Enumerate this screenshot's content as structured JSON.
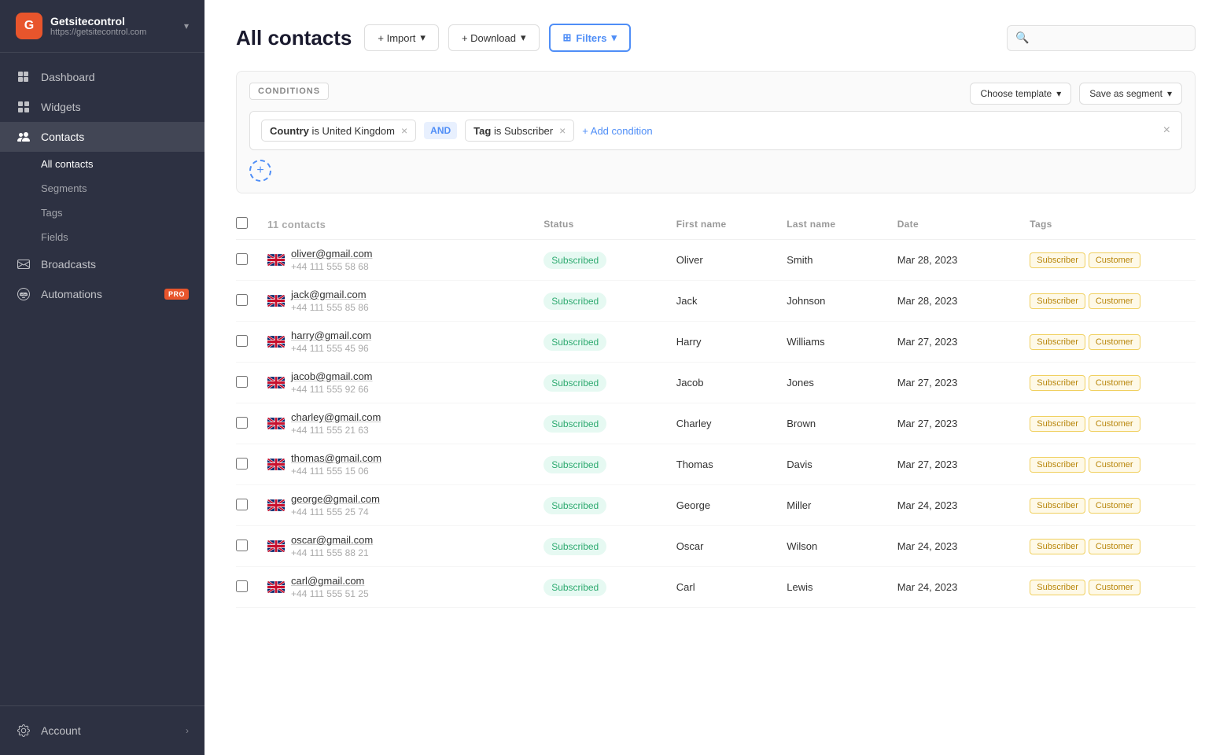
{
  "app": {
    "brand": "Getsitecontrol",
    "url": "https://getsitecontrol.com"
  },
  "sidebar": {
    "nav_items": [
      {
        "id": "dashboard",
        "label": "Dashboard",
        "icon": "grid"
      },
      {
        "id": "widgets",
        "label": "Widgets",
        "icon": "widget"
      },
      {
        "id": "contacts",
        "label": "Contacts",
        "icon": "contacts",
        "active": true
      },
      {
        "id": "broadcasts",
        "label": "Broadcasts",
        "icon": "email"
      },
      {
        "id": "automations",
        "label": "Automations",
        "icon": "auto",
        "pro": true
      }
    ],
    "contacts_sub": [
      {
        "id": "all-contacts",
        "label": "All contacts",
        "active": true
      },
      {
        "id": "segments",
        "label": "Segments"
      },
      {
        "id": "tags",
        "label": "Tags"
      },
      {
        "id": "fields",
        "label": "Fields"
      }
    ],
    "footer": {
      "label": "Account",
      "icon": "gear"
    }
  },
  "toolbar": {
    "import_label": "+ Import",
    "download_label": "+ Download",
    "filters_label": "⊞ Filters",
    "search_placeholder": ""
  },
  "page": {
    "title": "All contacts"
  },
  "conditions": {
    "label": "CONDITIONS",
    "choose_template": "Choose template",
    "save_as_segment": "Save as segment",
    "condition1_field": "Country",
    "condition1_op": "is",
    "condition1_val": "United Kingdom",
    "and_label": "AND",
    "condition2_field": "Tag",
    "condition2_op": "is",
    "condition2_val": "Subscriber",
    "add_condition": "+ Add condition"
  },
  "table": {
    "count_label": "11 contacts",
    "columns": {
      "status": "Status",
      "first_name": "First name",
      "last_name": "Last name",
      "date": "Date",
      "tags": "Tags"
    },
    "rows": [
      {
        "email": "oliver@gmail.com",
        "phone": "+44 111 555 58 68",
        "status": "Subscribed",
        "first_name": "Oliver",
        "last_name": "Smith",
        "date": "Mar 28, 2023",
        "tags": [
          "Subscriber",
          "Customer"
        ]
      },
      {
        "email": "jack@gmail.com",
        "phone": "+44 111 555 85 86",
        "status": "Subscribed",
        "first_name": "Jack",
        "last_name": "Johnson",
        "date": "Mar 28, 2023",
        "tags": [
          "Subscriber",
          "Customer"
        ]
      },
      {
        "email": "harry@gmail.com",
        "phone": "+44 111 555 45 96",
        "status": "Subscribed",
        "first_name": "Harry",
        "last_name": "Williams",
        "date": "Mar 27, 2023",
        "tags": [
          "Subscriber",
          "Customer"
        ]
      },
      {
        "email": "jacob@gmail.com",
        "phone": "+44 111 555 92 66",
        "status": "Subscribed",
        "first_name": "Jacob",
        "last_name": "Jones",
        "date": "Mar 27, 2023",
        "tags": [
          "Subscriber",
          "Customer"
        ]
      },
      {
        "email": "charley@gmail.com",
        "phone": "+44 111 555 21 63",
        "status": "Subscribed",
        "first_name": "Charley",
        "last_name": "Brown",
        "date": "Mar 27, 2023",
        "tags": [
          "Subscriber",
          "Customer"
        ]
      },
      {
        "email": "thomas@gmail.com",
        "phone": "+44 111 555 15 06",
        "status": "Subscribed",
        "first_name": "Thomas",
        "last_name": "Davis",
        "date": "Mar 27, 2023",
        "tags": [
          "Subscriber",
          "Customer"
        ]
      },
      {
        "email": "george@gmail.com",
        "phone": "+44 111 555 25 74",
        "status": "Subscribed",
        "first_name": "George",
        "last_name": "Miller",
        "date": "Mar 24, 2023",
        "tags": [
          "Subscriber",
          "Customer"
        ]
      },
      {
        "email": "oscar@gmail.com",
        "phone": "+44 111 555 88 21",
        "status": "Subscribed",
        "first_name": "Oscar",
        "last_name": "Wilson",
        "date": "Mar 24, 2023",
        "tags": [
          "Subscriber",
          "Customer"
        ]
      },
      {
        "email": "carl@gmail.com",
        "phone": "+44 111 555 51 25",
        "status": "Subscribed",
        "first_name": "Carl",
        "last_name": "Lewis",
        "date": "Mar 24, 2023",
        "tags": [
          "Subscriber",
          "Customer"
        ]
      }
    ]
  }
}
